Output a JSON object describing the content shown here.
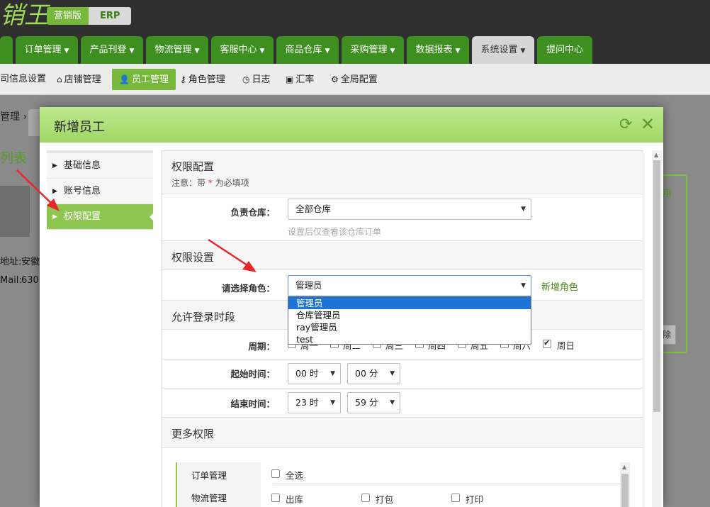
{
  "header": {
    "logo_text": "销王",
    "edition_a": "营销版",
    "edition_b": "ERP"
  },
  "main_nav": [
    {
      "label": "订单管理"
    },
    {
      "label": "产品刊登"
    },
    {
      "label": "物流管理"
    },
    {
      "label": "客服中心"
    },
    {
      "label": "商品仓库"
    },
    {
      "label": "采购管理"
    },
    {
      "label": "数据报表"
    },
    {
      "label": "系统设置"
    },
    {
      "label": "提问中心"
    }
  ],
  "sub_nav": [
    {
      "label": "司信息设置",
      "icon": "none"
    },
    {
      "label": "店铺管理",
      "icon": "home-icon"
    },
    {
      "label": "员工管理",
      "icon": "user-icon"
    },
    {
      "label": "角色管理",
      "icon": "key-icon"
    },
    {
      "label": "日志",
      "icon": "clock-icon"
    },
    {
      "label": "汇率",
      "icon": "money-icon"
    },
    {
      "label": "全局配置",
      "icon": "gear-icon"
    }
  ],
  "background_page": {
    "breadcrumb": "管理 ›",
    "title": "列表",
    "address_label": "地址:",
    "address_value": "安徽",
    "mail_label": "Mail:",
    "mail_value": "630",
    "card_title": "用",
    "button_label": "除"
  },
  "modal": {
    "title": "新增员工",
    "left_menu": [
      {
        "label": "基础信息"
      },
      {
        "label": "账号信息"
      },
      {
        "label": "权限配置"
      }
    ],
    "perm_config": {
      "title": "权限配置",
      "note_prefix": "注意：带",
      "note_star": "*",
      "note_suffix": "为必填项",
      "warehouse_label": "负责仓库：",
      "warehouse_value": "全部仓库",
      "warehouse_hint": "设置后仅查看该仓库订单"
    },
    "perm_settings": {
      "title": "权限设置",
      "role_label": "请选择角色：",
      "role_value": "管理员",
      "add_role_link": "新增角色",
      "role_options": [
        "管理员",
        "仓库管理员",
        "ray管理员",
        "test"
      ]
    },
    "login_time": {
      "title": "允许登录时段",
      "week_label": "周期：",
      "weekdays": [
        {
          "label": "周一",
          "checked": false
        },
        {
          "label": "周二",
          "checked": false
        },
        {
          "label": "周三",
          "checked": false
        },
        {
          "label": "周四",
          "checked": false
        },
        {
          "label": "周五",
          "checked": false
        },
        {
          "label": "周六",
          "checked": false
        },
        {
          "label": "周日",
          "checked": true
        }
      ],
      "start_label": "起始时间：",
      "start_hour": "00 时",
      "start_min": "00 分",
      "end_label": "结束时间：",
      "end_hour": "23 时",
      "end_min": "59 分"
    },
    "more_perms": {
      "title": "更多权限",
      "tabs": [
        {
          "label": "订单管理"
        },
        {
          "label": "物流管理"
        }
      ],
      "select_all": "全选",
      "items": [
        "出库",
        "打包",
        "打印"
      ]
    }
  },
  "colors": {
    "nav_green": "#3d8f1f",
    "accent_green": "#8fc651",
    "header_dark": "#2f2f2f",
    "arrow_red": "#e8252b"
  }
}
